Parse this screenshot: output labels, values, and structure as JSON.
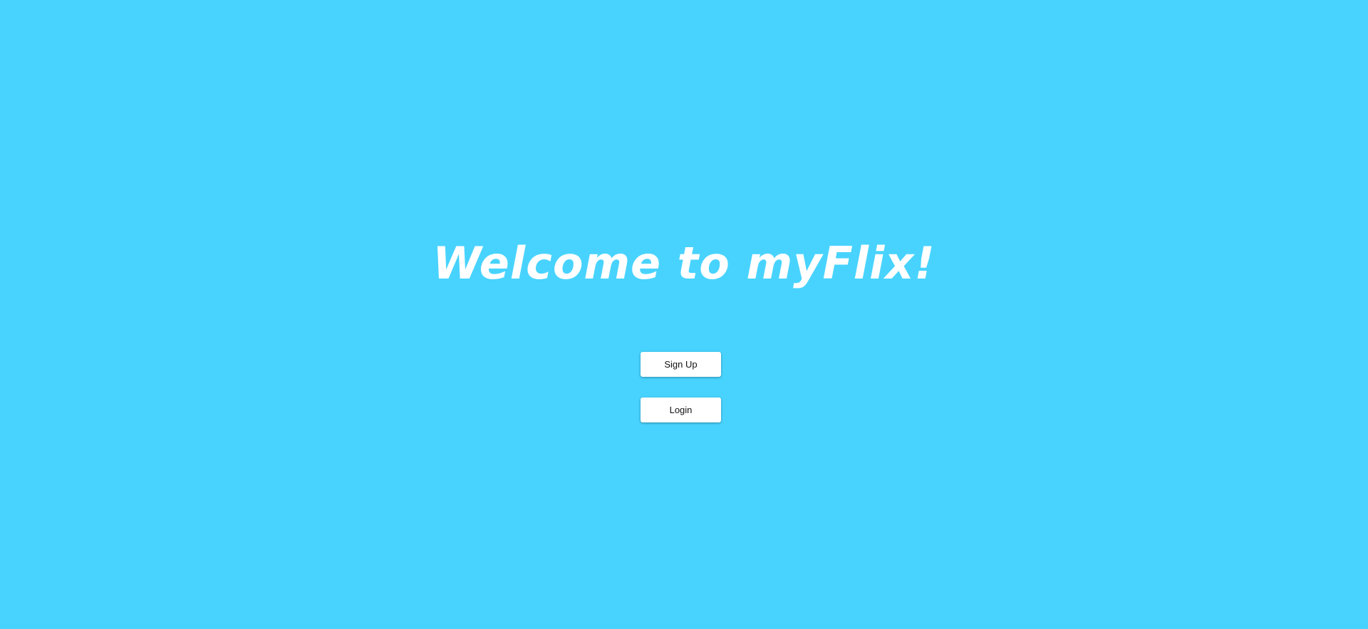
{
  "welcome": {
    "title": "Welcome to myFlix!"
  },
  "actions": {
    "signup_label": "Sign Up",
    "login_label": "Login"
  },
  "colors": {
    "background": "#48d3fe",
    "title": "#ffffff",
    "button_bg": "#ffffff",
    "button_text": "#111111"
  }
}
